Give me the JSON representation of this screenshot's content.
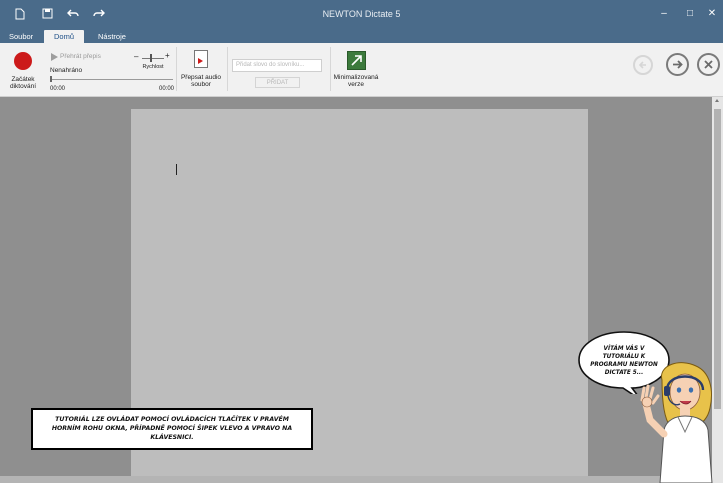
{
  "window": {
    "title": "NEWTON Dictate 5",
    "controls": {
      "minimize": "–",
      "maximize": "□",
      "close": "✕"
    }
  },
  "menu": {
    "tabs": [
      {
        "label": "Soubor"
      },
      {
        "label": "Domů"
      },
      {
        "label": "Nástroje"
      }
    ]
  },
  "ribbon": {
    "record": {
      "label": "Začátek diktování"
    },
    "playback": {
      "play_label": "Přehrát přepis",
      "status": "Nenahráno",
      "time_start": "00:00",
      "time_end": "00:00"
    },
    "speed": {
      "label": "Rychlost",
      "minus": "–",
      "plus": "+"
    },
    "audio": {
      "label": "Přepsat audio soubor"
    },
    "dictionary": {
      "placeholder": "Přidat slovo do slovníku...",
      "button": "PŘIDAT"
    },
    "minimize_view": {
      "label": "Minimalizovaná verze"
    }
  },
  "tutorial_nav": {
    "back_icon": "arrow-left-circle-icon",
    "forward_icon": "arrow-right-circle-icon",
    "close_icon": "close-circle-icon"
  },
  "tutorial": {
    "box_text": "TUTORIÁL LZE OVLÁDAT POMOCÍ OVLÁDACÍCH TLAČÍTEK V PRAVÉM HORNÍM ROHU OKNA, PŘÍPADNĚ POMOCÍ ŠIPEK VLEVO A VPRAVO NA KLÁVESNICI.",
    "bubble_text": "VÍTÁM VÁS V TUTORIÁLU K PROGRAMU NEWTON DICTATE 5..."
  },
  "colors": {
    "titlebar": "#4a6b8a",
    "record": "#cc1a1a",
    "accent": "#1d4f87"
  }
}
